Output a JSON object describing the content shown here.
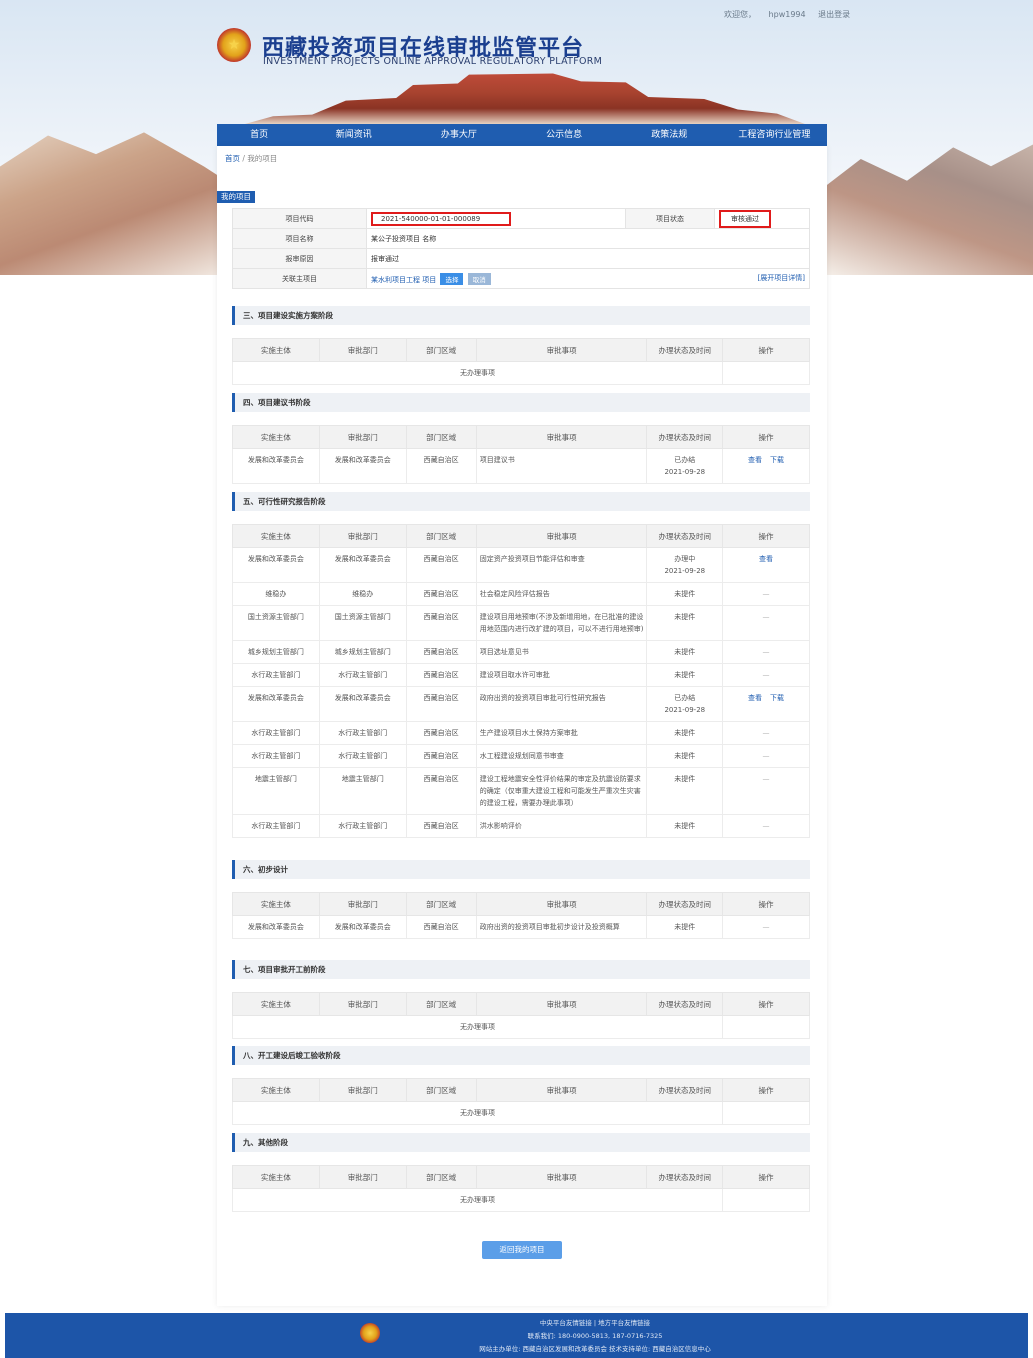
{
  "header": {
    "top_links": [
      "欢迎您，",
      "hpw1994",
      "退出登录"
    ],
    "title_cn": "西藏投资项目在线审批监管平台",
    "title_en": "INVESTMENT PROJECTS ONLINE APPROVAL REGULATORY PLATFORM"
  },
  "nav": [
    "首页",
    "新闻资讯",
    "办事大厅",
    "公示信息",
    "政策法规",
    "工程咨询行业管理"
  ],
  "breadcrumb": {
    "home": "首页",
    "sep": "/",
    "current": "我的项目"
  },
  "tab_label": "我的项目",
  "info": {
    "code_label": "项目代码",
    "code_value": "2021-540000-01-01-000089",
    "status_label": "项目状态",
    "status_value": "审核通过",
    "name_label": "项目名称",
    "name_value": "某公子投资项目 名称",
    "reason_label": "报审原因",
    "reason_value": "报审通过",
    "link_label": "关联主项目",
    "link_value": "某水利项目工程 项目",
    "btn_select": "选择",
    "btn_cancel": "取消",
    "expand_link": "[展开项目详情]"
  },
  "columns": [
    "实施主体",
    "审批部门",
    "部门区域",
    "审批事项",
    "办理状态及时间",
    "操作"
  ],
  "empty_text": "无办理事项",
  "sections": {
    "s3": {
      "title": "三、项目建设实施方案阶段"
    },
    "s4": {
      "title": "四、项目建议书阶段",
      "rows": [
        [
          "发展和改革委员会",
          "发展和改革委员会",
          "西藏自治区",
          "项目建议书",
          "已办结\n2021-09-28",
          "查看   下载"
        ]
      ]
    },
    "s5": {
      "title": "五、可行性研究报告阶段",
      "rows": [
        [
          "发展和改革委员会",
          "发展和改革委员会",
          "西藏自治区",
          "固定资产投资项目节能评估和审查",
          "办理中\n2021-09-28",
          "查看"
        ],
        [
          "维稳办",
          "维稳办",
          "西藏自治区",
          "社会稳定风险评估报告",
          "未提件",
          "—"
        ],
        [
          "国土资源主管部门",
          "国土资源主管部门",
          "西藏自治区",
          "建设项目用地预审(不涉及新增用地，在已批准的建设用地范围内进行改扩建的项目，可以不进行用地预审)",
          "未提件",
          "—"
        ],
        [
          "城乡规划主管部门",
          "城乡规划主管部门",
          "西藏自治区",
          "项目选址意见书",
          "未提件",
          "—"
        ],
        [
          "水行政主管部门",
          "水行政主管部门",
          "西藏自治区",
          "建设项目取水许可审批",
          "未提件",
          "—"
        ],
        [
          "发展和改革委员会",
          "发展和改革委员会",
          "西藏自治区",
          "政府出资的投资项目审批可行性研究报告",
          "已办结\n2021-09-28",
          "查看   下载"
        ],
        [
          "水行政主管部门",
          "水行政主管部门",
          "西藏自治区",
          "生产建设项目水土保持方案审批",
          "未提件",
          "—"
        ],
        [
          "水行政主管部门",
          "水行政主管部门",
          "西藏自治区",
          "水工程建设规划同意书审查",
          "未提件",
          "—"
        ],
        [
          "地震主管部门",
          "地震主管部门",
          "西藏自治区",
          "建设工程地震安全性评价结果的审定及抗震设防要求的确定（仅审重大建设工程和可能发生严重次生灾害的建设工程，需要办理此事项）",
          "未提件",
          "—"
        ],
        [
          "水行政主管部门",
          "水行政主管部门",
          "西藏自治区",
          "洪水影响评价",
          "未提件",
          "—"
        ]
      ]
    },
    "s6": {
      "title": "六、初步设计",
      "rows": [
        [
          "发展和改革委员会",
          "发展和改革委员会",
          "西藏自治区",
          "政府出资的投资项目审批初步设计及投资概算",
          "未提件",
          "—"
        ]
      ]
    },
    "s7": {
      "title": "七、项目审批开工前阶段"
    },
    "s8": {
      "title": "八、开工建设后竣工验收阶段"
    },
    "s9": {
      "title": "九、其他阶段"
    }
  },
  "return_button": "返回我的项目",
  "footer": {
    "line1": "中央平台友情链接 | 地方平台友情链接",
    "line2": "联系我们: 180-0900-5813, 187-0716-7325",
    "line3": "网站主办单位: 西藏自治区发展和改革委员会  技术支持单位: 西藏自治区信息中心"
  }
}
